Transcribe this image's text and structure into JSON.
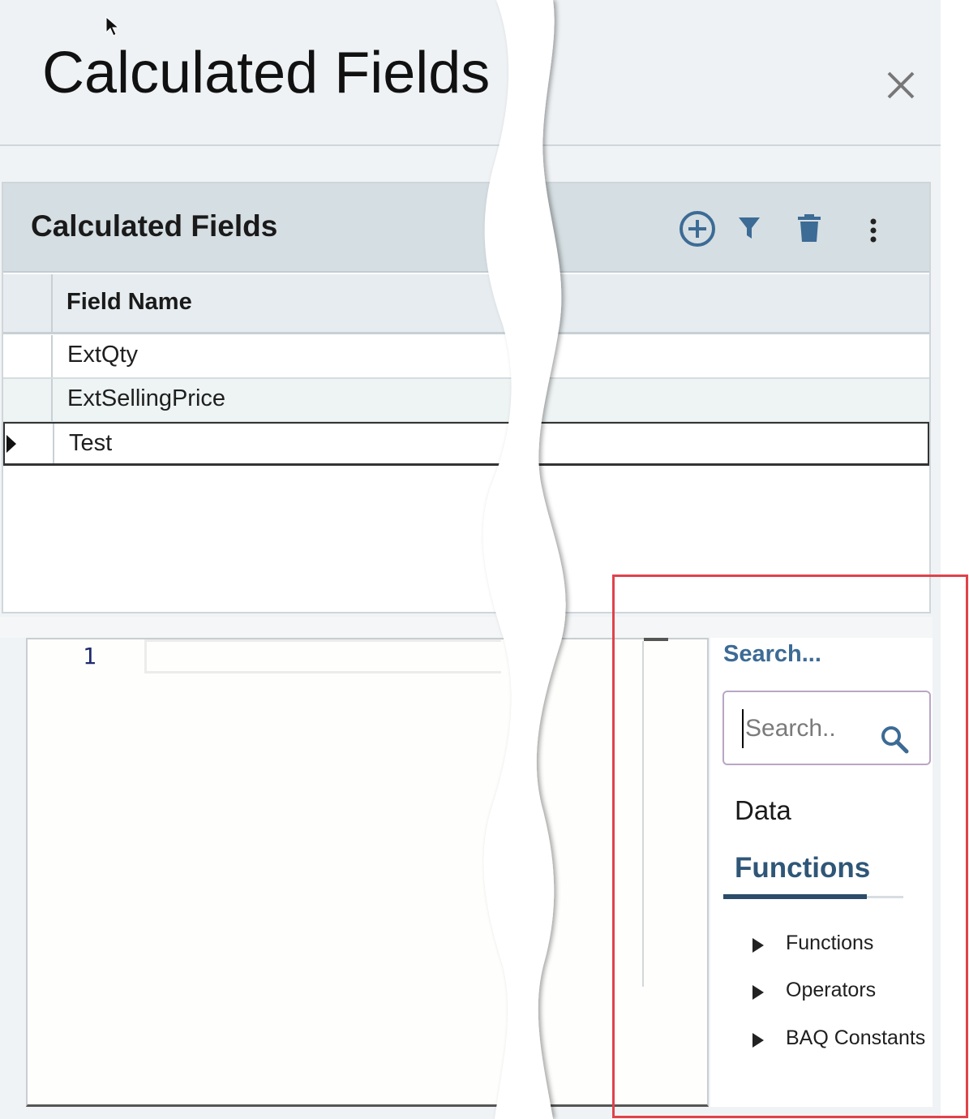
{
  "dialog": {
    "title": "Calculated Fields",
    "close_icon": "close-icon"
  },
  "panel": {
    "title": "Calculated Fields",
    "toolbar": {
      "add_icon": "add-circle-icon",
      "filter_icon": "filter-icon",
      "delete_icon": "trash-icon",
      "more_icon": "more-vertical-icon"
    }
  },
  "grid": {
    "columns": [
      "Field Name"
    ],
    "rows": [
      {
        "field_name": "ExtQty",
        "selected": false
      },
      {
        "field_name": "ExtSellingPrice",
        "selected": false
      },
      {
        "field_name": "Test",
        "selected": true
      }
    ]
  },
  "editor": {
    "line_numbers": [
      "1"
    ],
    "code": ""
  },
  "side_panel": {
    "search_heading": "Search...",
    "search_placeholder": "Search..",
    "tabs": [
      "Data",
      "Functions"
    ],
    "active_tab": "Functions",
    "tree": [
      "Functions",
      "Operators",
      "BAQ Constants"
    ]
  },
  "colors": {
    "accent": "#3c6b95",
    "tab_underline": "#2b4c6a",
    "highlight": "#e0424a"
  }
}
